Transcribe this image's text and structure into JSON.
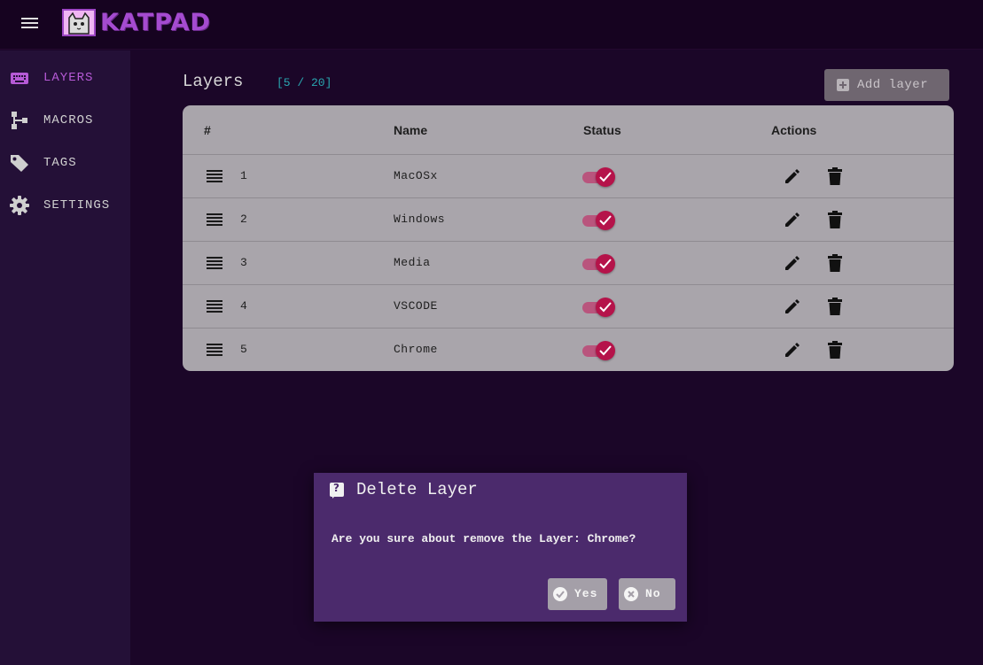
{
  "app": {
    "brand": "KATPAD"
  },
  "sidebar": {
    "items": [
      {
        "label": "LAYERS",
        "icon": "keyboard-icon",
        "active": true
      },
      {
        "label": "MACROS",
        "icon": "macro-tree-icon",
        "active": false
      },
      {
        "label": "TAGS",
        "icon": "tag-icon",
        "active": false
      },
      {
        "label": "SETTINGS",
        "icon": "gear-icon",
        "active": false
      }
    ]
  },
  "main": {
    "title": "Layers",
    "count": "[5 / 20]",
    "add_label": "Add layer",
    "table": {
      "headers": {
        "index": "#",
        "name": "Name",
        "status": "Status",
        "actions": "Actions"
      },
      "rows": [
        {
          "index": "1",
          "name": "MacOSx",
          "enabled": true
        },
        {
          "index": "2",
          "name": "Windows",
          "enabled": true
        },
        {
          "index": "3",
          "name": "Media",
          "enabled": true
        },
        {
          "index": "4",
          "name": "VSCODE",
          "enabled": true
        },
        {
          "index": "5",
          "name": "Chrome",
          "enabled": true
        }
      ]
    }
  },
  "dialog": {
    "title": "Delete Layer",
    "message": "Are you sure about remove the Layer: Chrome?",
    "yes_label": "Yes",
    "no_label": "No"
  },
  "colors": {
    "accent": "#b65ad6",
    "count_badge": "#29a6b0",
    "toggle_on": "#b5134a",
    "dialog_bg": "#4b2a6c"
  }
}
